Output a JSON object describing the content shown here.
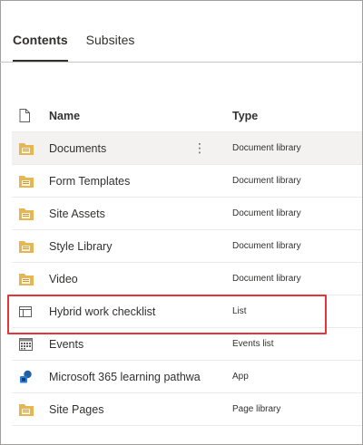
{
  "tabs": [
    {
      "label": "Contents",
      "active": true
    },
    {
      "label": "Subsites",
      "active": false
    }
  ],
  "columns": {
    "name": "Name",
    "type": "Type"
  },
  "rows": [
    {
      "name": "Documents",
      "type": "Document library",
      "icon": "folder-icon",
      "selected": true
    },
    {
      "name": "Form Templates",
      "type": "Document library",
      "icon": "folder-icon"
    },
    {
      "name": "Site Assets",
      "type": "Document library",
      "icon": "folder-icon"
    },
    {
      "name": "Style Library",
      "type": "Document library",
      "icon": "folder-icon"
    },
    {
      "name": "Video",
      "type": "Document library",
      "icon": "folder-icon"
    },
    {
      "name": "Hybrid work checklist",
      "type": "List",
      "icon": "list-icon",
      "highlighted": true
    },
    {
      "name": "Events",
      "type": "Events list",
      "icon": "calendar-icon"
    },
    {
      "name": "Microsoft 365 learning pathwa",
      "type": "App",
      "icon": "app-icon"
    },
    {
      "name": "Site Pages",
      "type": "Page library",
      "icon": "folder-icon"
    }
  ],
  "colors": {
    "folder": "#e8b650",
    "folder_dark": "#c9963a",
    "highlight": "#e5343a",
    "app": "#1f5fa8",
    "selected_row": "#f3f2f1"
  }
}
